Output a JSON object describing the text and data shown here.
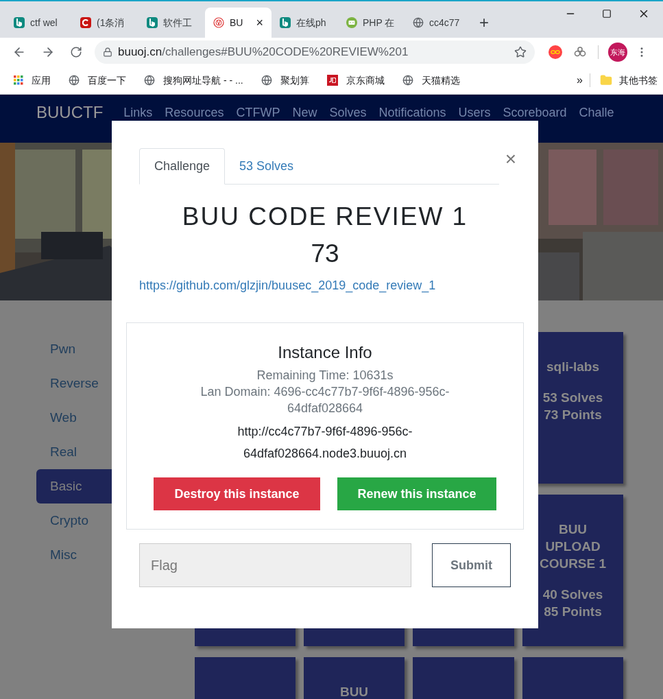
{
  "browser": {
    "tabs": [
      {
        "title": "ctf wel",
        "kind": "bing",
        "selected": false
      },
      {
        "title": "(1条消",
        "kind": "csdn",
        "selected": false
      },
      {
        "title": "软件工",
        "kind": "bing",
        "selected": false
      },
      {
        "title": "BU",
        "kind": "buu",
        "selected": true,
        "close": "×"
      },
      {
        "title": "在线ph",
        "kind": "bing",
        "selected": false
      },
      {
        "title": "PHP 在",
        "kind": "php",
        "selected": false
      },
      {
        "title": "cc4c77",
        "kind": "globe",
        "selected": false
      }
    ],
    "new_tab": "+",
    "url": {
      "host": "buuoj.cn",
      "path": "/challenges#BUU%20CODE%20REVIEW%201"
    },
    "profile": "东海",
    "bookmarks": [
      {
        "label": "应用",
        "kind": "apps"
      },
      {
        "label": "百度一下",
        "kind": "globe"
      },
      {
        "label": "搜狗网址导航 -  - ...",
        "kind": "globe"
      },
      {
        "label": "聚划算",
        "kind": "globe"
      },
      {
        "label": "京东商城",
        "kind": "jd"
      },
      {
        "label": "天猫精选",
        "kind": "globe"
      }
    ],
    "more_bookmarks": "»",
    "other_bookmarks": "其他书签"
  },
  "navbar": {
    "brand": "BUUCTF",
    "links": [
      "Links",
      "Resources",
      "CTFWP",
      "New",
      "Solves",
      "Notifications",
      "Users",
      "Scoreboard",
      "Challe"
    ]
  },
  "sidebar": {
    "items": [
      {
        "label": "Pwn",
        "selected": false
      },
      {
        "label": "Reverse",
        "selected": false
      },
      {
        "label": "Web",
        "selected": false
      },
      {
        "label": "Real",
        "selected": false
      },
      {
        "label": "Basic",
        "selected": true
      },
      {
        "label": "Crypto",
        "selected": false
      },
      {
        "label": "Misc",
        "selected": false
      }
    ]
  },
  "tiles": [
    {
      "kind": "hidden"
    },
    {
      "kind": "hidden"
    },
    {
      "kind": "hidden"
    },
    {
      "kind": "challenge",
      "name": "sqli-labs",
      "solves": "53 Solves",
      "points": "73 Points"
    },
    {
      "kind": "covered"
    },
    {
      "kind": "covered"
    },
    {
      "kind": "covered"
    },
    {
      "kind": "challenge",
      "name": "BUU UPLOAD COURSE 1",
      "solves": "40 Solves",
      "points": "85 Points"
    },
    {
      "kind": "covered"
    },
    {
      "kind": "challenge",
      "name": "BUU"
    },
    {
      "kind": "covered"
    },
    {
      "kind": "covered"
    }
  ],
  "modal": {
    "tabs": [
      {
        "label": "Challenge",
        "selected": true
      },
      {
        "label": "53 Solves",
        "selected": false
      }
    ],
    "close": "×",
    "title": "BUU CODE REVIEW 1",
    "value": "73",
    "link": "https://github.com/glzjin/buusec_2019_code_review_1",
    "instance": {
      "heading": "Instance Info",
      "remaining": "Remaining Time: 10631s",
      "domain": "Lan Domain: 4696-cc4c77b7-9f6f-4896-956c-64dfaf028664",
      "url": "http://cc4c77b7-9f6f-4896-956c-64dfaf028664.node3.buuoj.cn",
      "destroy": "Destroy this instance",
      "renew": "Renew this instance"
    },
    "flag": {
      "placeholder": "Flag"
    },
    "submit": "Submit"
  }
}
